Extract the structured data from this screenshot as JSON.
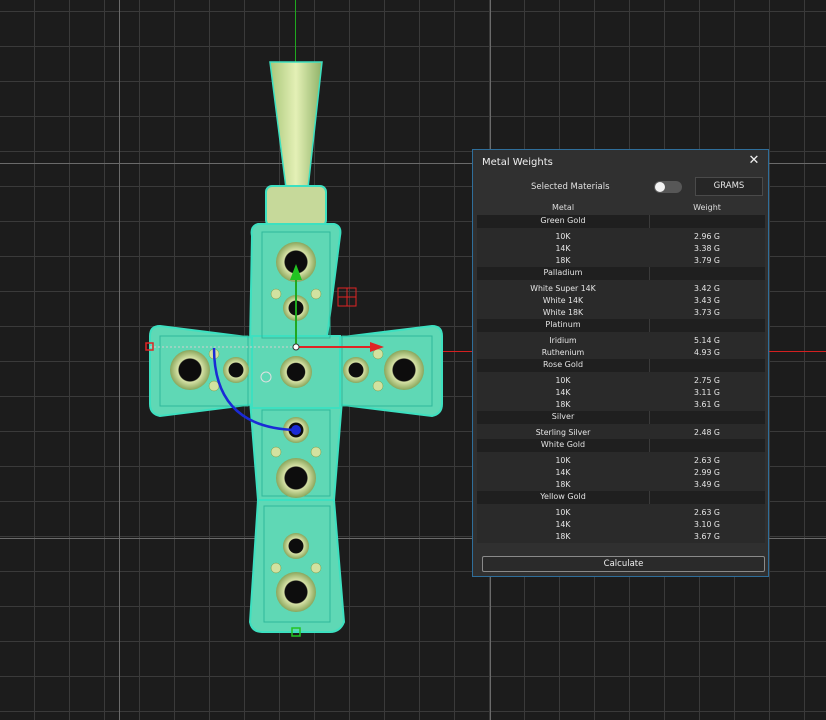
{
  "panel": {
    "title": "Metal Weights",
    "close_icon": "close-icon",
    "selected_materials_label": "Selected Materials",
    "selected_materials_toggle_on": false,
    "unit_button_label": "GRAMS",
    "columns": {
      "metal": "Metal",
      "weight": "Weight"
    },
    "groups": [
      {
        "name": "Green Gold",
        "items": [
          {
            "metal": "10K",
            "weight": "2.96 G"
          },
          {
            "metal": "14K",
            "weight": "3.38 G"
          },
          {
            "metal": "18K",
            "weight": "3.79 G"
          }
        ]
      },
      {
        "name": "Palladium",
        "items": [
          {
            "metal": "White Super 14K",
            "weight": "3.42 G"
          },
          {
            "metal": "White 14K",
            "weight": "3.43 G"
          },
          {
            "metal": "White 18K",
            "weight": "3.73 G"
          }
        ]
      },
      {
        "name": "Platinum",
        "items": [
          {
            "metal": "Iridium",
            "weight": "5.14 G"
          },
          {
            "metal": "Ruthenium",
            "weight": "4.93 G"
          }
        ]
      },
      {
        "name": "Rose Gold",
        "items": [
          {
            "metal": "10K",
            "weight": "2.75 G"
          },
          {
            "metal": "14K",
            "weight": "3.11 G"
          },
          {
            "metal": "18K",
            "weight": "3.61 G"
          }
        ]
      },
      {
        "name": "Silver",
        "items": [
          {
            "metal": "Sterling Silver",
            "weight": "2.48 G"
          }
        ]
      },
      {
        "name": "White Gold",
        "items": [
          {
            "metal": "10K",
            "weight": "2.63 G"
          },
          {
            "metal": "14K",
            "weight": "2.99 G"
          },
          {
            "metal": "18K",
            "weight": "3.49 G"
          }
        ]
      },
      {
        "name": "Yellow Gold",
        "items": [
          {
            "metal": "10K",
            "weight": "2.63 G"
          },
          {
            "metal": "14K",
            "weight": "3.10 G"
          },
          {
            "metal": "18K",
            "weight": "3.67 G"
          }
        ]
      }
    ],
    "calculate_label": "Calculate"
  },
  "viewport": {
    "background": "#1c1c1c",
    "grid_color": "#3a3a3a",
    "y_axis_color": "#1fa81f",
    "x_axis_color": "#d42020",
    "model_wireframe_color": "#3de0c0",
    "model_surface_color": "#b8d28a",
    "rotate_gizmo_color": "#1a2bd6"
  }
}
